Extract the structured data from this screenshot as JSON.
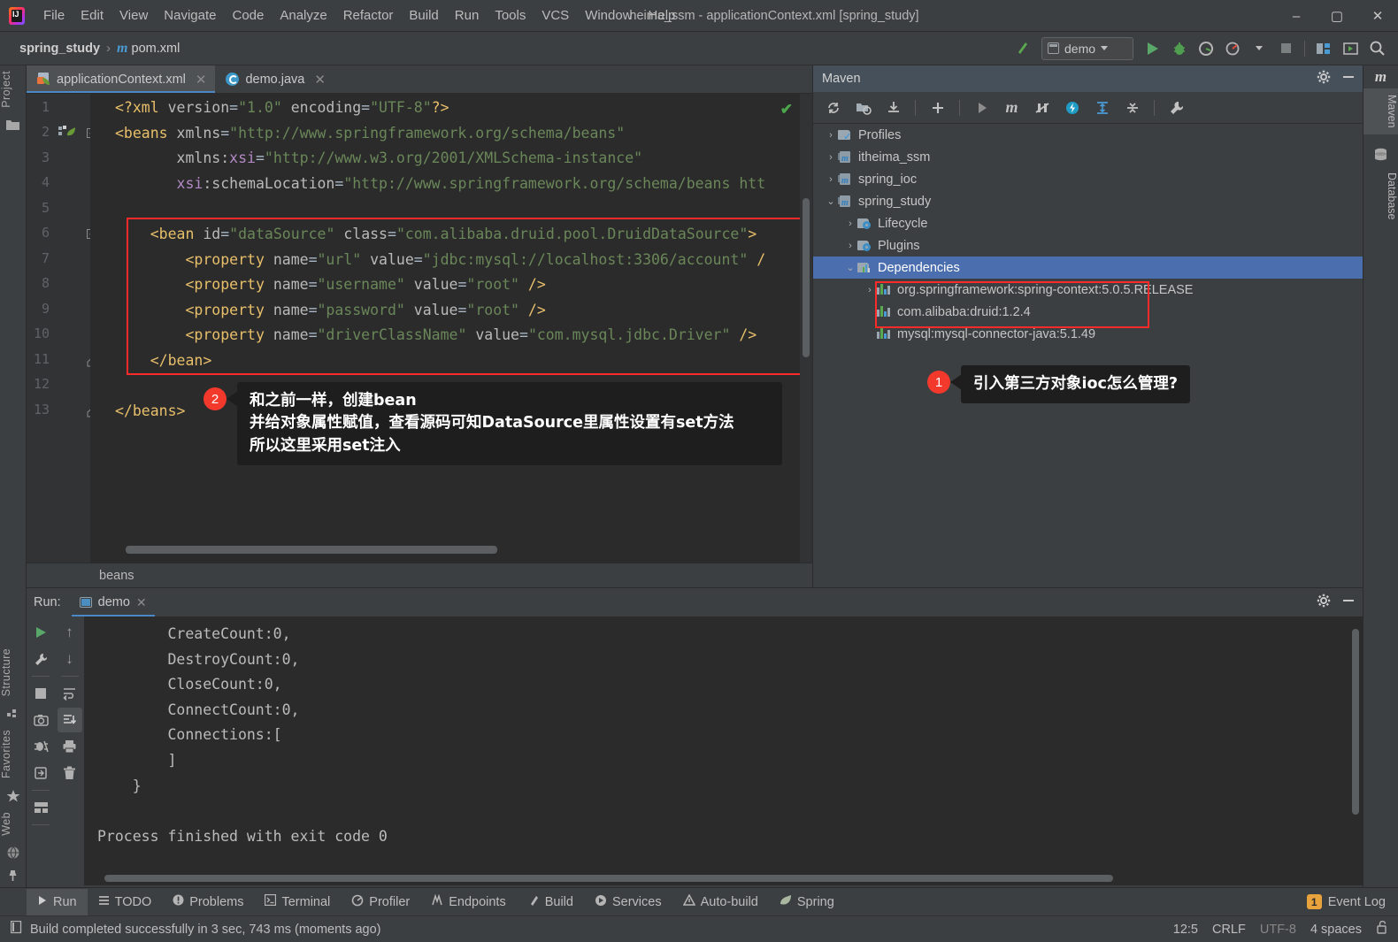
{
  "window": {
    "title": "heima_ssm - applicationContext.xml [spring_study]",
    "minimize": "–",
    "maximize": "▢",
    "close": "✕"
  },
  "menubar": [
    {
      "label": "File"
    },
    {
      "label": "Edit"
    },
    {
      "label": "View"
    },
    {
      "label": "Navigate"
    },
    {
      "label": "Code"
    },
    {
      "label": "Analyze"
    },
    {
      "label": "Refactor"
    },
    {
      "label": "Build"
    },
    {
      "label": "Run"
    },
    {
      "label": "Tools"
    },
    {
      "label": "VCS"
    },
    {
      "label": "Window"
    },
    {
      "label": "Help"
    }
  ],
  "breadcrumb": {
    "project": "spring_study",
    "separator": "›",
    "file": "pom.xml",
    "maven_m": "m"
  },
  "toolbar": {
    "run_configuration": "demo",
    "dropdown_caret": "▾"
  },
  "left_strip": {
    "project_tab": "Project",
    "structure_tab": "Structure",
    "favorites_tab": "Favorites",
    "web_tab": "Web"
  },
  "right_strip": {
    "maven_tab": "Maven",
    "database_tab": "Database"
  },
  "editor": {
    "tabs": [
      {
        "label": "applicationContext.xml",
        "active": true,
        "close": "✕"
      },
      {
        "label": "demo.java",
        "active": false,
        "close": "✕"
      }
    ],
    "line_numbers": [
      "1",
      "2",
      "3",
      "4",
      "5",
      "6",
      "7",
      "8",
      "9",
      "10",
      "11",
      "12",
      "13"
    ],
    "lines": [
      "<?xml version=\"1.0\" encoding=\"UTF-8\"?>",
      "<beans xmlns=\"http://www.springframework.org/schema/beans\"",
      "       xmlns:xsi=\"http://www.w3.org/2001/XMLSchema-instance\"",
      "       xsi:schemaLocation=\"http://www.springframework.org/schema/beans htt",
      "",
      "    <bean id=\"dataSource\" class=\"com.alibaba.druid.pool.DruidDataSource\">",
      "        <property name=\"url\" value=\"jdbc:mysql://localhost:3306/account\" /",
      "        <property name=\"username\" value=\"root\" />",
      "        <property name=\"password\" value=\"root\" />",
      "        <property name=\"driverClassName\" value=\"com.mysql.jdbc.Driver\" />",
      "    </bean>",
      "",
      "</beans>"
    ],
    "breadcrumb_footer": "beans",
    "inspection_ok": "✔"
  },
  "maven": {
    "title": "Maven",
    "tree": [
      {
        "label": "Profiles",
        "depth": 0,
        "arrow": "›",
        "icon": "folder-check-icon",
        "selected": false
      },
      {
        "label": "itheima_ssm",
        "depth": 0,
        "arrow": "›",
        "icon": "maven-module-icon",
        "selected": false
      },
      {
        "label": "spring_ioc",
        "depth": 0,
        "arrow": "›",
        "icon": "maven-module-icon",
        "selected": false
      },
      {
        "label": "spring_study",
        "depth": 0,
        "arrow": "⌄",
        "icon": "maven-module-icon",
        "selected": false
      },
      {
        "label": "Lifecycle",
        "depth": 1,
        "arrow": "›",
        "icon": "folder-gear-icon",
        "selected": false
      },
      {
        "label": "Plugins",
        "depth": 1,
        "arrow": "›",
        "icon": "folder-gear-icon",
        "selected": false
      },
      {
        "label": "Dependencies",
        "depth": 1,
        "arrow": "⌄",
        "icon": "dependencies-folder-icon",
        "selected": true
      },
      {
        "label": "org.springframework:spring-context:5.0.5.RELEASE",
        "depth": 2,
        "arrow": "›",
        "icon": "library-bars-icon",
        "selected": false
      },
      {
        "label": "com.alibaba:druid:1.2.4",
        "depth": 2,
        "arrow": "",
        "icon": "library-bars-icon",
        "selected": false
      },
      {
        "label": "mysql:mysql-connector-java:5.1.49",
        "depth": 2,
        "arrow": "",
        "icon": "library-bars-icon",
        "selected": false
      }
    ]
  },
  "annotations": [
    {
      "number": "1",
      "text": "引入第三方对象ioc怎么管理?"
    },
    {
      "number": "2",
      "line1": "和之前一样，创建bean",
      "line2": "并给对象属性赋值，查看源码可知DataSource里属性设置有set方法",
      "line3": "所以这里采用set注入"
    }
  ],
  "run_panel": {
    "label": "Run:",
    "tab": "demo",
    "tab_close": "✕",
    "output": "        CreateCount:0,\n        DestroyCount:0,\n        CloseCount:0,\n        ConnectCount:0,\n        Connections:[\n        ]\n    }\n\nProcess finished with exit code 0"
  },
  "bottom_bar": [
    {
      "label": "Run",
      "icon": "play-icon",
      "active": true
    },
    {
      "label": "TODO",
      "icon": "list-icon",
      "active": false
    },
    {
      "label": "Problems",
      "icon": "warning-circle-icon",
      "active": false
    },
    {
      "label": "Terminal",
      "icon": "terminal-icon",
      "active": false
    },
    {
      "label": "Profiler",
      "icon": "profiler-icon",
      "active": false
    },
    {
      "label": "Endpoints",
      "icon": "endpoints-icon",
      "active": false
    },
    {
      "label": "Build",
      "icon": "hammer-icon",
      "active": false
    },
    {
      "label": "Services",
      "icon": "services-icon",
      "active": false
    },
    {
      "label": "Auto-build",
      "icon": "autobuild-icon",
      "active": false
    },
    {
      "label": "Spring",
      "icon": "spring-leaf-icon",
      "active": false
    }
  ],
  "status_bar": {
    "message": "Build completed successfully in 3 sec, 743 ms (moments ago)",
    "event_log": "Event Log",
    "event_log_count": "1",
    "caret": "12:5",
    "line_separator": "CRLF",
    "encoding": "UTF-8",
    "indent": "4 spaces",
    "lock": "🔓"
  },
  "colors": {
    "accent": "#4b6eaf",
    "highlight_red": "#fc2a28",
    "badge_red": "#f2392c",
    "bg_panel": "#3c3f41",
    "bg_editor": "#2b2b2b",
    "string_green": "#6a8759",
    "tag_yellow": "#e8bf6a",
    "ns_purple": "#b389c5"
  }
}
